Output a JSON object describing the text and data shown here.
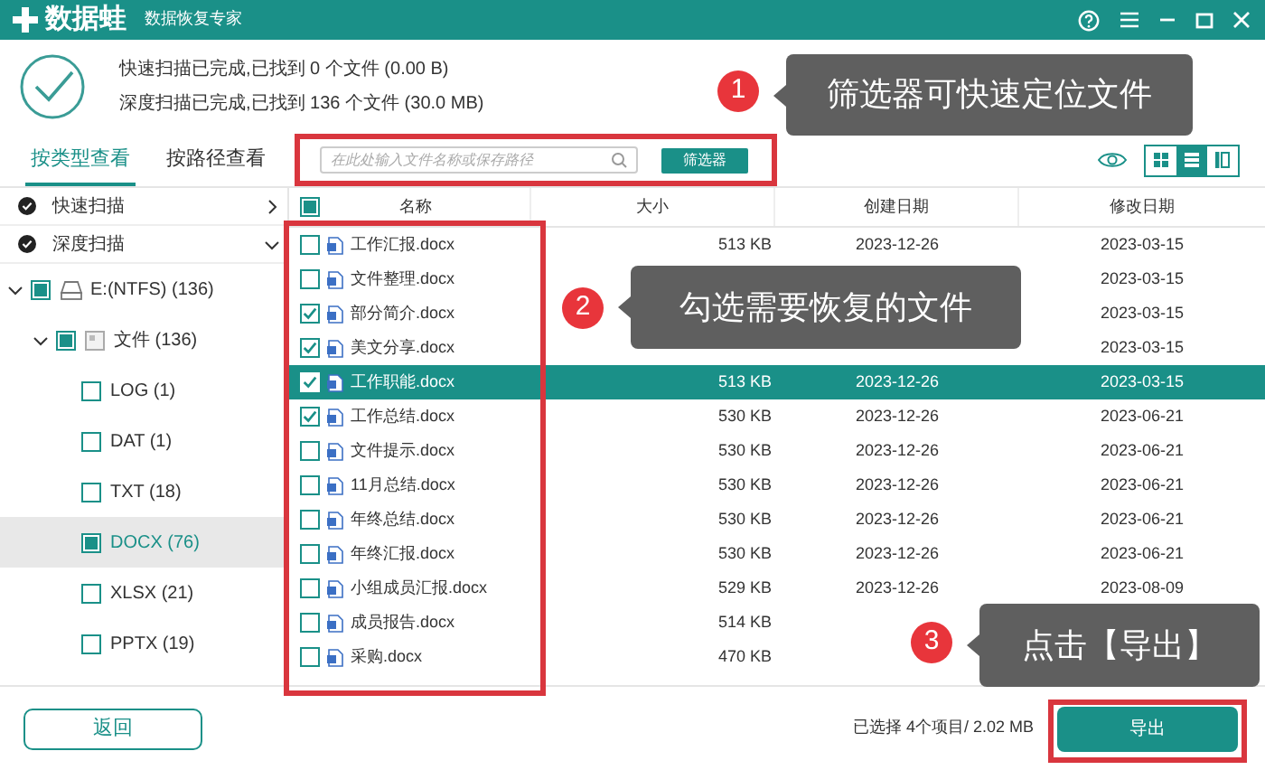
{
  "window": {
    "logo": "数据蛙",
    "subtitle": "数据恢复专家"
  },
  "scan_status": [
    "快速扫描已完成,已找到 0 个文件 (0.00  B)",
    "深度扫描已完成,已找到 136 个文件 (30.0 MB)"
  ],
  "view_tabs": [
    {
      "label": "按类型查看",
      "selected": true
    },
    {
      "label": "按路径查看",
      "selected": false
    }
  ],
  "search": {
    "placeholder": "在此处输入文件名称或保存路径"
  },
  "filter_button": "筛选器",
  "view_modes": [
    {
      "kind": "grid",
      "selected": false
    },
    {
      "kind": "list",
      "selected": true
    },
    {
      "kind": "detail",
      "selected": false
    }
  ],
  "scans": [
    {
      "label": "快速扫描",
      "expanded": false
    },
    {
      "label": "深度扫描",
      "expanded": true
    }
  ],
  "tree": [
    {
      "label": "E:(NTFS) (136)",
      "kind": "drive",
      "checked": false,
      "indeterminate": true,
      "selected": false,
      "expanded": true,
      "children": [
        {
          "label": "文件 (136)",
          "kind": "folder",
          "checked": false,
          "indeterminate": true,
          "selected": false,
          "expanded": true,
          "children": [
            {
              "label": "LOG (1)",
              "checked": false,
              "indeterminate": false,
              "selected": false
            },
            {
              "label": "DAT (1)",
              "checked": false,
              "indeterminate": false,
              "selected": false
            },
            {
              "label": "TXT (18)",
              "checked": false,
              "indeterminate": false,
              "selected": false
            },
            {
              "label": "DOCX (76)",
              "checked": false,
              "indeterminate": true,
              "selected": true
            },
            {
              "label": "XLSX (21)",
              "checked": false,
              "indeterminate": false,
              "selected": false
            },
            {
              "label": "PPTX (19)",
              "checked": false,
              "indeterminate": false,
              "selected": false
            }
          ]
        }
      ]
    }
  ],
  "table": {
    "header_checkbox": {
      "checked": false,
      "indeterminate": true
    },
    "columns": [
      "名称",
      "大小",
      "创建日期",
      "修改日期"
    ],
    "rows": [
      {
        "name": "工作汇报.docx",
        "size": "513 KB",
        "created": "2023-12-26",
        "modified": "2023-03-15",
        "checked": false,
        "selected": false
      },
      {
        "name": "文件整理.docx",
        "modified": "2023-03-15",
        "checked": false,
        "selected": false
      },
      {
        "name": "部分简介.docx",
        "modified": "2023-03-15",
        "checked": true,
        "selected": false
      },
      {
        "name": "美文分享.docx",
        "modified": "2023-03-15",
        "checked": true,
        "selected": false
      },
      {
        "name": "工作职能.docx",
        "size": "513 KB",
        "created": "2023-12-26",
        "modified": "2023-03-15",
        "checked": true,
        "selected": true
      },
      {
        "name": "工作总结.docx",
        "size": "530 KB",
        "created": "2023-12-26",
        "modified": "2023-06-21",
        "checked": true,
        "selected": false
      },
      {
        "name": "文件提示.docx",
        "size": "530 KB",
        "created": "2023-12-26",
        "modified": "2023-06-21",
        "checked": false,
        "selected": false
      },
      {
        "name": "11月总结.docx",
        "size": "530 KB",
        "created": "2023-12-26",
        "modified": "2023-06-21",
        "checked": false,
        "selected": false
      },
      {
        "name": "年终总结.docx",
        "size": "530 KB",
        "created": "2023-12-26",
        "modified": "2023-06-21",
        "checked": false,
        "selected": false
      },
      {
        "name": "年终汇报.docx",
        "size": "530 KB",
        "created": "2023-12-26",
        "modified": "2023-06-21",
        "checked": false,
        "selected": false
      },
      {
        "name": "小组成员汇报.docx",
        "size": "529 KB",
        "created": "2023-12-26",
        "modified": "2023-08-09",
        "checked": false,
        "selected": false
      },
      {
        "name": "成员报告.docx",
        "size": "514 KB",
        "checked": false,
        "selected": false
      },
      {
        "name": "采购.docx",
        "size": "470 KB",
        "checked": false,
        "selected": false
      }
    ]
  },
  "footer": {
    "back_button": "返回",
    "selection_summary": "已选择 4个项目/ 2.02 MB",
    "export_button": "导出"
  },
  "callouts": [
    {
      "number": "1",
      "text": "筛选器可快速定位文件"
    },
    {
      "number": "2",
      "text": "勾选需要恢复的文件"
    },
    {
      "number": "3",
      "text": "点击【导出】"
    }
  ]
}
